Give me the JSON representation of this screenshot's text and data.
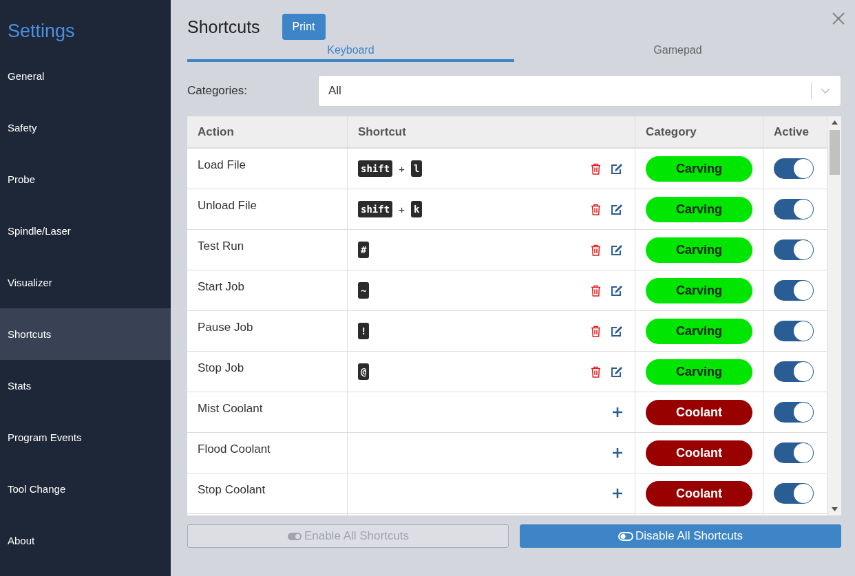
{
  "sidebar": {
    "title": "Settings",
    "items": [
      {
        "label": "General",
        "selected": false
      },
      {
        "label": "Safety",
        "selected": false
      },
      {
        "label": "Probe",
        "selected": false
      },
      {
        "label": "Spindle/Laser",
        "selected": false
      },
      {
        "label": "Visualizer",
        "selected": false
      },
      {
        "label": "Shortcuts",
        "selected": true
      },
      {
        "label": "Stats",
        "selected": false
      },
      {
        "label": "Program Events",
        "selected": false
      },
      {
        "label": "Tool Change",
        "selected": false
      },
      {
        "label": "About",
        "selected": false
      }
    ]
  },
  "header": {
    "title": "Shortcuts",
    "print_button": "Print"
  },
  "tabs": [
    {
      "label": "Keyboard",
      "selected": true
    },
    {
      "label": "Gamepad",
      "selected": false
    }
  ],
  "filter": {
    "label": "Categories:",
    "value": "All"
  },
  "table": {
    "columns": [
      "Action",
      "Shortcut",
      "Category",
      "Active"
    ],
    "rows": [
      {
        "action": "Load File",
        "shortcut": [
          {
            "kind": "key",
            "text": "shift"
          },
          {
            "kind": "plus",
            "text": "+"
          },
          {
            "kind": "key",
            "text": "l"
          }
        ],
        "category": {
          "label": "Carving",
          "color": "#00e600"
        },
        "on": true
      },
      {
        "action": "Unload File",
        "shortcut": [
          {
            "kind": "key",
            "text": "shift"
          },
          {
            "kind": "plus",
            "text": "+"
          },
          {
            "kind": "key",
            "text": "k"
          }
        ],
        "category": {
          "label": "Carving",
          "color": "#00e600"
        },
        "on": true
      },
      {
        "action": "Test Run",
        "shortcut": [
          {
            "kind": "key",
            "text": "#"
          }
        ],
        "category": {
          "label": "Carving",
          "color": "#00e600"
        },
        "on": true
      },
      {
        "action": "Start Job",
        "shortcut": [
          {
            "kind": "key",
            "text": "~"
          }
        ],
        "category": {
          "label": "Carving",
          "color": "#00e600"
        },
        "on": true
      },
      {
        "action": "Pause Job",
        "shortcut": [
          {
            "kind": "key",
            "text": "!"
          }
        ],
        "category": {
          "label": "Carving",
          "color": "#00e600"
        },
        "on": true
      },
      {
        "action": "Stop Job",
        "shortcut": [
          {
            "kind": "key",
            "text": "@"
          }
        ],
        "category": {
          "label": "Carving",
          "color": "#00e600"
        },
        "on": true
      },
      {
        "action": "Mist Coolant",
        "category": {
          "label": "Coolant",
          "color": "#990000"
        },
        "on": true
      },
      {
        "action": "Flood Coolant",
        "category": {
          "label": "Coolant",
          "color": "#990000"
        },
        "on": true
      },
      {
        "action": "Stop Coolant",
        "category": {
          "label": "Coolant",
          "color": "#990000"
        },
        "on": true
      }
    ]
  },
  "buttons": [
    {
      "label": "Enable All Shortcuts",
      "disabled": true
    },
    {
      "label": "Disable All Shortcuts",
      "disabled": false
    }
  ]
}
